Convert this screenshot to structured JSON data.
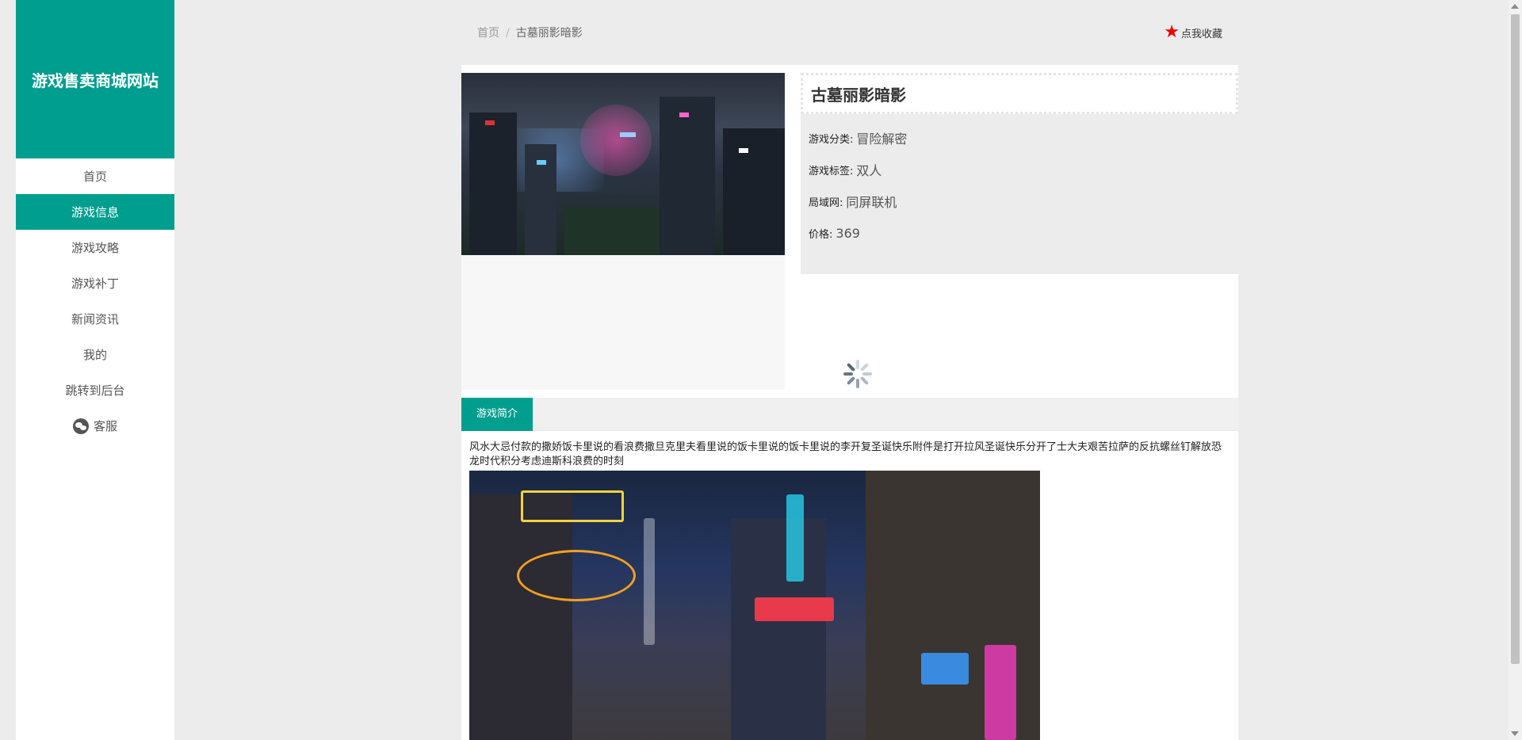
{
  "sidebar": {
    "brand": "游戏售卖商城网站",
    "items": [
      {
        "label": "首页",
        "active": false
      },
      {
        "label": "游戏信息",
        "active": true
      },
      {
        "label": "游戏攻略",
        "active": false
      },
      {
        "label": "游戏补丁",
        "active": false
      },
      {
        "label": "新闻资讯",
        "active": false
      },
      {
        "label": "我的",
        "active": false
      },
      {
        "label": "跳转到后台",
        "active": false
      }
    ],
    "service_label": "客服",
    "service_icon": "wechat-icon"
  },
  "breadcrumb": {
    "home": "首页",
    "separator": "/",
    "current": "古墓丽影暗影"
  },
  "favorite": {
    "icon": "star-icon",
    "label": "点我收藏"
  },
  "game": {
    "title": "古墓丽影暗影",
    "fields": [
      {
        "label": "游戏分类:",
        "value": "冒险解密"
      },
      {
        "label": "游戏标签:",
        "value": "双人"
      },
      {
        "label": "局域网:",
        "value": "同屏联机"
      },
      {
        "label": "价格:",
        "value": "369"
      }
    ]
  },
  "intro": {
    "tab_label": "游戏简介",
    "text": "风水大忌付款的撒娇饭卡里说的看浪费撒旦克里夫看里说的饭卡里说的饭卡里说的李开复圣诞快乐附件是打开拉风圣诞快乐分开了士大夫艰苦拉萨的反抗螺丝钉解放恐龙时代积分考虑迪斯科浪费的时刻"
  },
  "colors": {
    "accent": "#009e8f",
    "star": "#e00000"
  }
}
